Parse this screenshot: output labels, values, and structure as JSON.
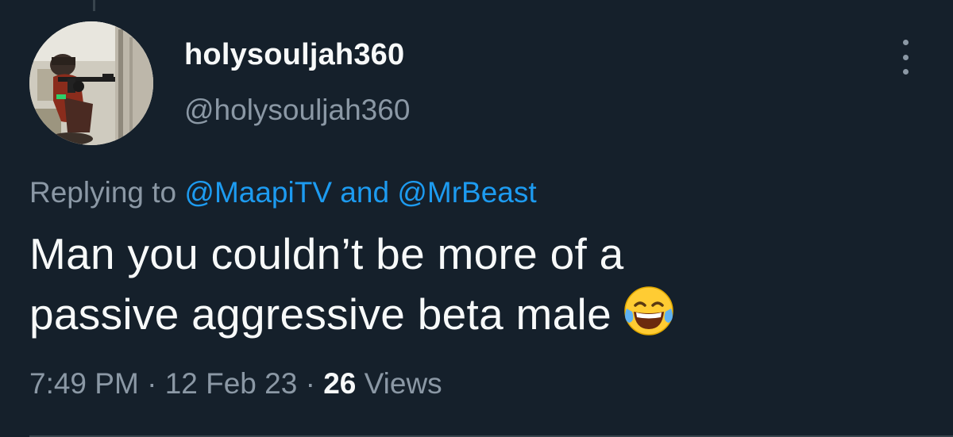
{
  "tweet": {
    "display_name": "holysouljah360",
    "handle": "@holysouljah360",
    "reply": {
      "prefix": "Replying to",
      "mention_1": "@MaapiTV",
      "conjunction": "and",
      "mention_2": "@MrBeast"
    },
    "text_line_1": "Man you couldn’t be more of a",
    "text_line_2": "passive aggressive beta male",
    "emoji": "face-with-tears-of-joy",
    "time": "7:49 PM",
    "separator": "·",
    "date": "12 Feb 23",
    "views_count": "26",
    "views_label": "Views"
  },
  "icons": {
    "more": "more-vertical-icon",
    "emoji": "face-with-tears-of-joy-icon"
  },
  "colors": {
    "background": "#15202b",
    "primary_text": "#f7f9f9",
    "secondary_text": "#8b98a5",
    "link": "#1d9bf0",
    "divider": "#38444d"
  }
}
